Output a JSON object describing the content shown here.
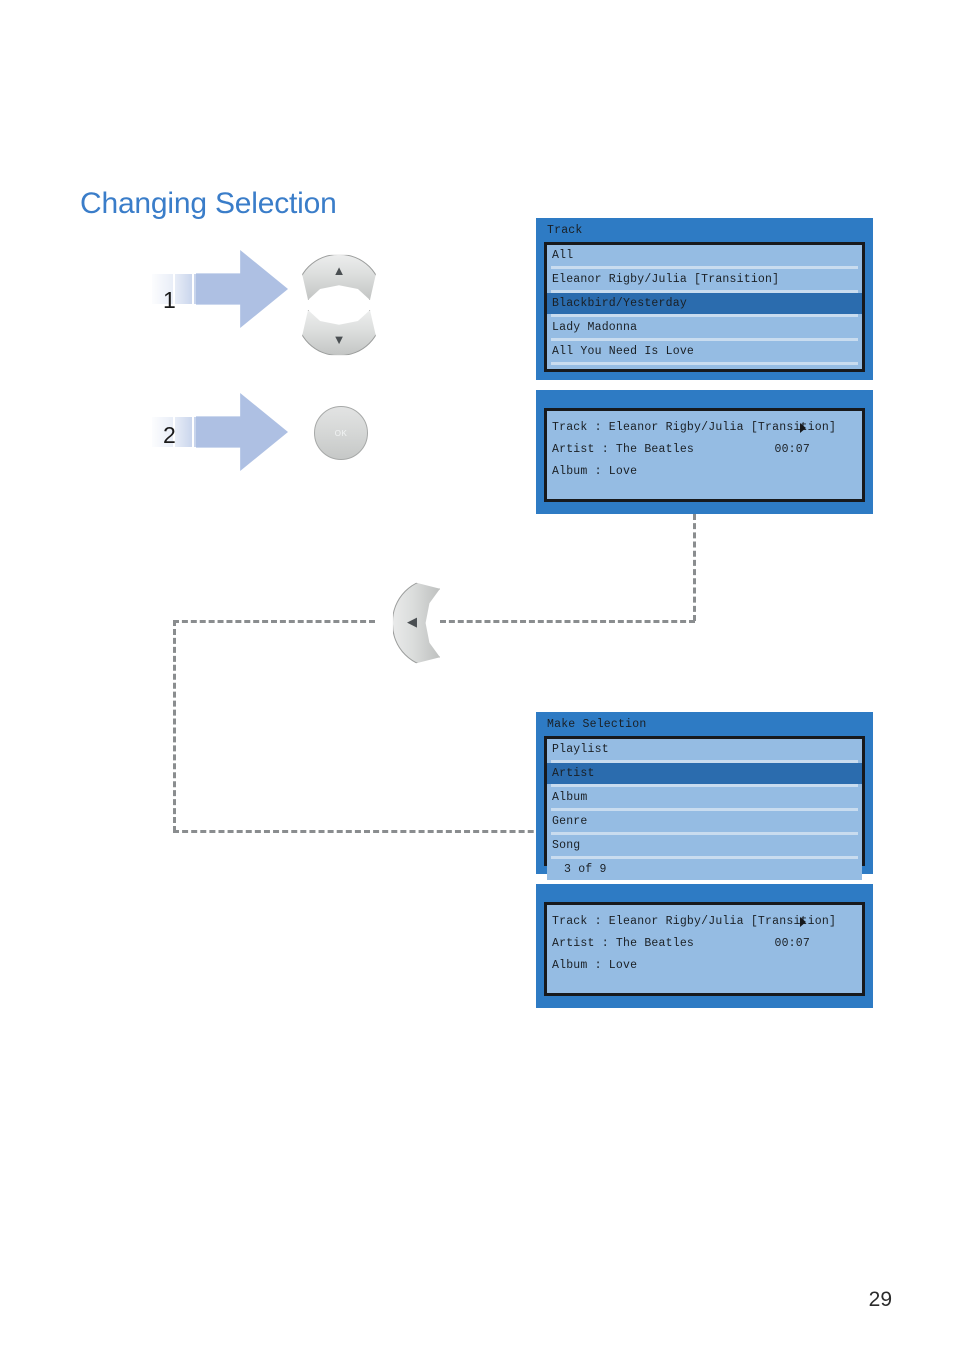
{
  "page": {
    "title": "Changing Selection",
    "number": "29"
  },
  "steps": [
    {
      "label": "1",
      "target": "up-down-buttons"
    },
    {
      "label": "2",
      "target": "ok-button"
    }
  ],
  "controls": {
    "up_button": {
      "name": "up-arrow-button",
      "glyph": "▲"
    },
    "down_button": {
      "name": "down-arrow-button",
      "glyph": "▼"
    },
    "left_button": {
      "name": "left-arrow-button",
      "glyph": "◀"
    },
    "ok_button": {
      "label": "OK"
    }
  },
  "screens": {
    "track_list": {
      "title": "Track",
      "rows": [
        {
          "label": "All",
          "selected": false
        },
        {
          "label": "Eleanor Rigby/Julia [Transition]",
          "selected": false
        },
        {
          "label": "Blackbird/Yesterday",
          "selected": true
        },
        {
          "label": "Lady Madonna",
          "selected": false
        },
        {
          "label": "All You Need Is Love",
          "selected": false
        }
      ]
    },
    "now_playing_top": {
      "title": "",
      "track_label": "Track : Eleanor Rigby/Julia [Transition]",
      "artist_label": "Artist : The Beatles",
      "album_label": "Album : Love",
      "time": "00:07"
    },
    "make_selection": {
      "title": "Make Selection",
      "rows": [
        {
          "label": "Playlist",
          "selected": false
        },
        {
          "label": "Artist",
          "selected": true
        },
        {
          "label": "Album",
          "selected": false
        },
        {
          "label": "Genre",
          "selected": false
        },
        {
          "label": "Song",
          "selected": false
        }
      ],
      "footer": "3 of 9"
    },
    "now_playing_bottom": {
      "title": "",
      "track_label": "Track : Eleanor Rigby/Julia [Transition]",
      "artist_label": "Artist : The Beatles",
      "album_label": "Album : Love",
      "time": "00:07"
    }
  },
  "colors": {
    "title": "#3a7dc9",
    "panel_chrome": "#2e7bc4",
    "panel_content": "#95bce3",
    "row_selected": "#2b6cae",
    "arrow": "#aec0e3"
  }
}
